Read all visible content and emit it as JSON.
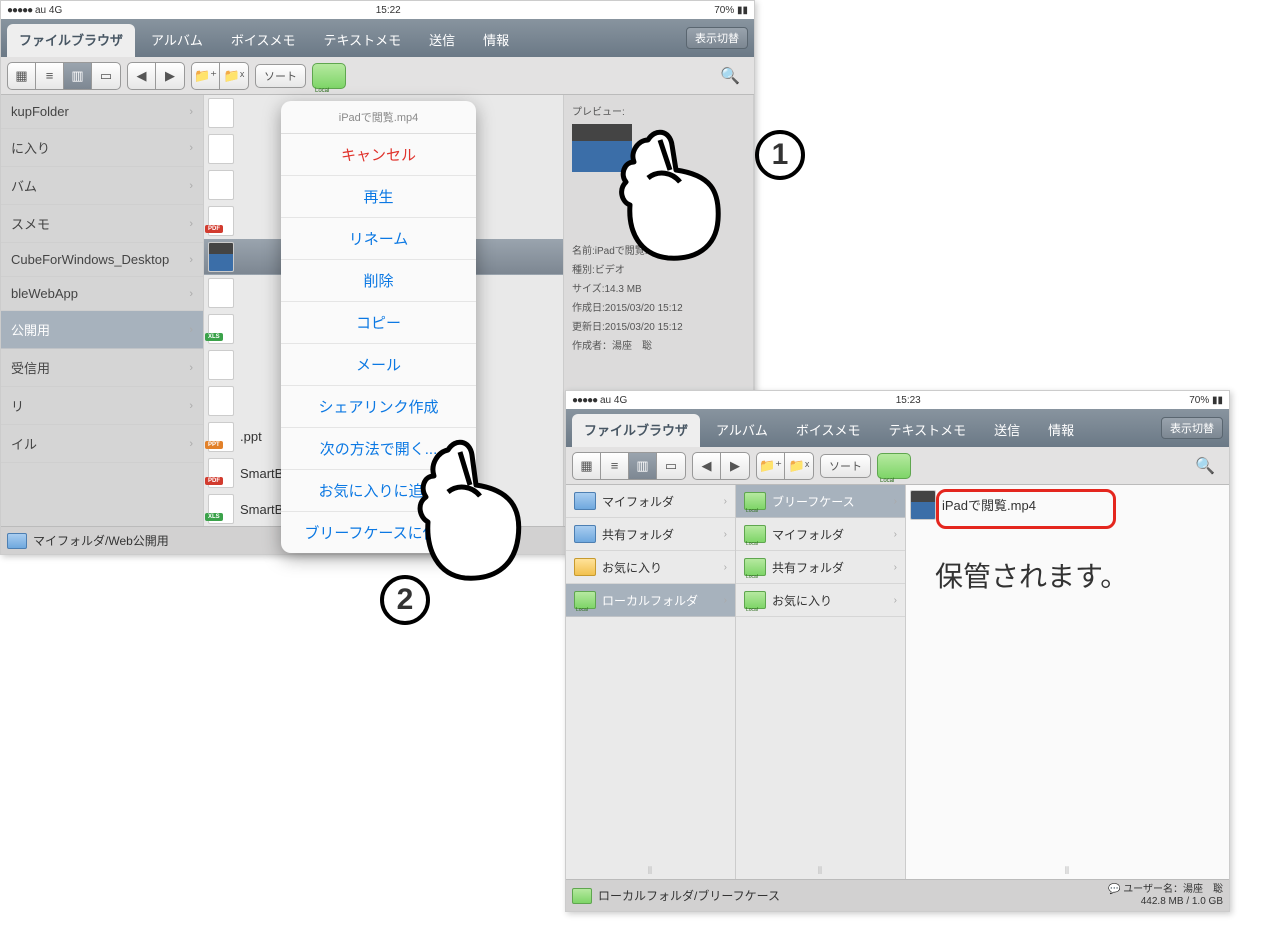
{
  "shot1": {
    "status": {
      "carrier": "au",
      "net": "4G",
      "time": "15:22",
      "battery": "70%"
    },
    "tabs": {
      "active": "ファイルブラウザ",
      "others": [
        "アルバム",
        "ボイスメモ",
        "テキストメモ",
        "送信",
        "情報"
      ],
      "rightbtn": "表示切替"
    },
    "toolbar": {
      "sort": "ソート"
    },
    "sidebar": [
      "kupFolder",
      "に入り",
      "バム",
      "スメモ",
      "CubeForWindows_Desktop",
      "bleWebApp",
      "公開用",
      "受信用",
      "リ",
      "イル"
    ],
    "sidebar_selected_index": 6,
    "files": [
      {
        "name": "",
        "tag": ""
      },
      {
        "name": "",
        "tag": ""
      },
      {
        "name": "",
        "tag": ""
      },
      {
        "name": "",
        "tag": "pdf"
      },
      {
        "name": "",
        "tag": "",
        "video": true,
        "selected": true
      },
      {
        "name": "",
        "tag": ""
      },
      {
        "name": "",
        "tag": "xls"
      },
      {
        "name": "",
        "tag": ""
      },
      {
        "name": "",
        "tag": ""
      },
      {
        "name": " .ppt",
        "tag": "ppt"
      },
      {
        "name": "SmartBiz+SDKユーザー         1.00.pdf",
        "tag": "pdf"
      },
      {
        "name": "SmartBiz+セキュリティ関連",
        "tag": "xls"
      }
    ],
    "sheet": {
      "title": "iPadで閲覧.mp4",
      "options": [
        "キャンセル",
        "再生",
        "リネーム",
        "削除",
        "コピー",
        "メール",
        "シェアリンク作成",
        "次の方法で開く...",
        "お気に入りに追加",
        "ブリーフケースに保存"
      ]
    },
    "preview": {
      "title": "プレビュー:",
      "lines": {
        "name": "名前:iPadで閲覧.mp4",
        "kind": "種別:ビデオ",
        "size": "サイズ:14.3 MB",
        "created": "作成日:2015/03/20 15:12",
        "updated": "更新日:2015/03/20 15:12",
        "author": "作成者：湯座　聡"
      }
    },
    "footer": "マイフォルダ/Web公開用"
  },
  "shot2": {
    "status": {
      "carrier": "au",
      "net": "4G",
      "time": "15:23",
      "battery": "70%"
    },
    "tabs": {
      "active": "ファイルブラウザ",
      "others": [
        "アルバム",
        "ボイスメモ",
        "テキストメモ",
        "送信",
        "情報"
      ],
      "rightbtn": "表示切替"
    },
    "toolbar": {
      "sort": "ソート"
    },
    "col1": [
      {
        "label": "マイフォルダ",
        "color": "blue"
      },
      {
        "label": "共有フォルダ",
        "color": "blue"
      },
      {
        "label": "お気に入り",
        "color": "star"
      },
      {
        "label": "ローカルフォルダ",
        "color": "green",
        "selected": true
      }
    ],
    "col2": [
      {
        "label": "ブリーフケース",
        "color": "green",
        "selected": true
      },
      {
        "label": "マイフォルダ",
        "color": "green"
      },
      {
        "label": "共有フォルダ",
        "color": "green"
      },
      {
        "label": "お気に入り",
        "color": "green"
      }
    ],
    "file": "iPadで閲覧.mp4",
    "footer_left": "ローカルフォルダ/ブリーフケース",
    "footer_right1": "ユーザー名：湯座　聡",
    "footer_right2": "442.8 MB / 1.0 GB"
  },
  "annot": {
    "num1": "①",
    "num2": "②",
    "text": "保管されます。"
  }
}
